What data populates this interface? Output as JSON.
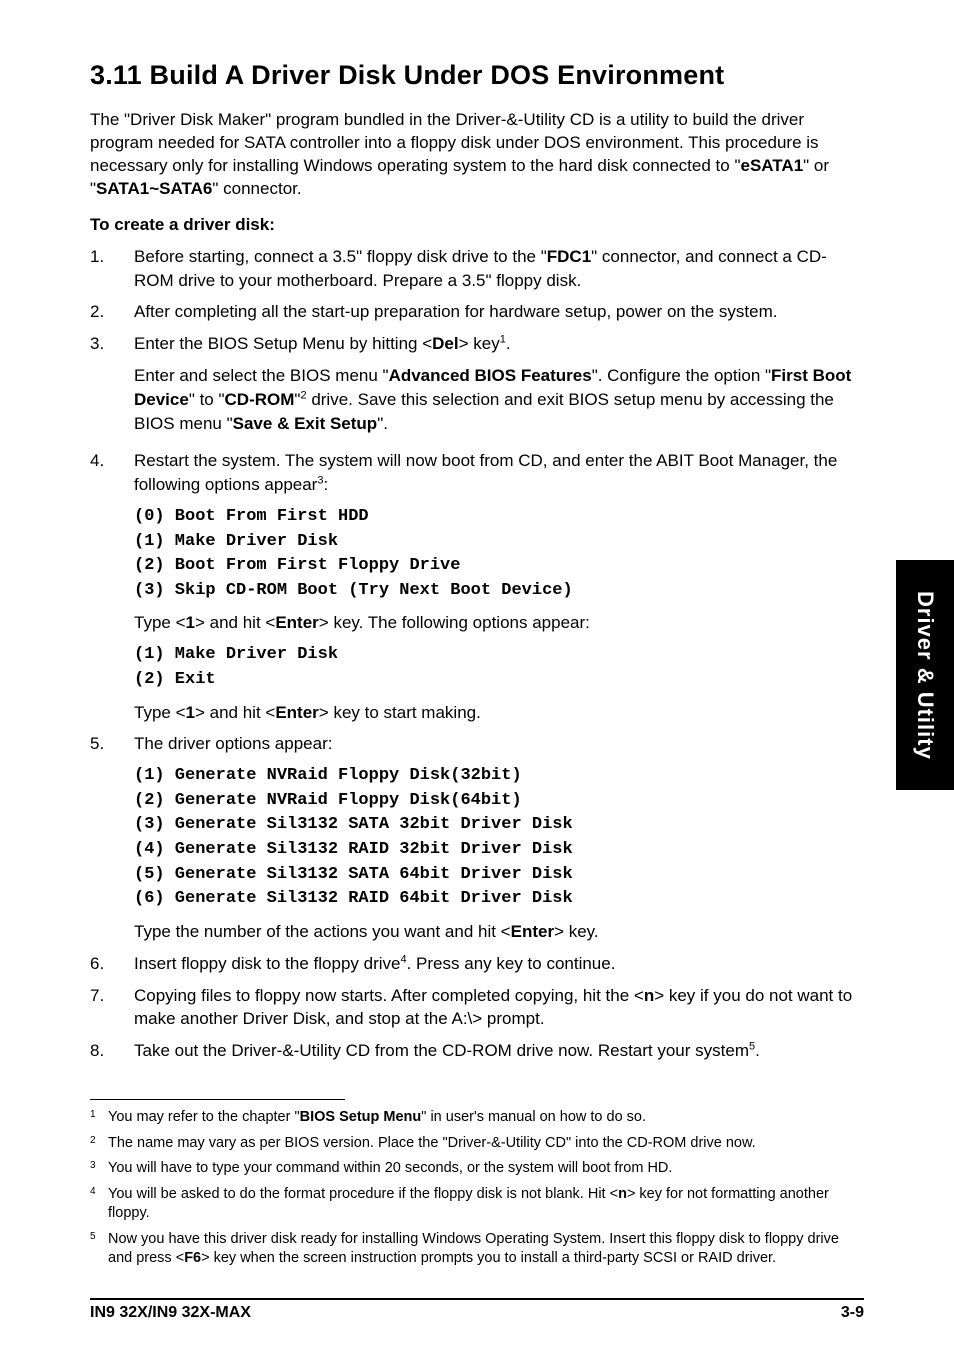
{
  "sideTab": "Driver & Utility",
  "title": "3.11 Build A Driver Disk Under DOS Environment",
  "intro": {
    "pre": "The \"Driver Disk Maker\" program bundled in the Driver-&-Utility CD is a utility to build the driver program needed for SATA controller into a floppy disk under DOS environment. This procedure is necessary only for installing Windows operating system to the hard disk connected to \"",
    "b1": "eSATA1",
    "mid": "\" or \"",
    "b2": "SATA1~SATA6",
    "post": "\" connector."
  },
  "subhead": "To create a driver disk:",
  "step1": {
    "pre": "Before starting, connect a 3.5\" floppy disk drive to the \"",
    "b": "FDC1",
    "post": "\" connector, and connect a CD-ROM drive to your motherboard. Prepare a 3.5\" floppy disk."
  },
  "step2": "After completing all the start-up preparation for hardware setup, power on the system.",
  "step3a": {
    "pre": "Enter the BIOS Setup Menu by hitting <",
    "b": "Del",
    "post": "> key",
    "sup": "1",
    "end": "."
  },
  "step3b": {
    "t1": "Enter and select the BIOS menu \"",
    "b1": "Advanced BIOS Features",
    "t2": "\". Configure the option \"",
    "b2": "First Boot Device",
    "t3": "\" to \"",
    "b3": "CD-ROM",
    "t4": "\"",
    "sup": "2",
    "t5": " drive. Save this selection and exit BIOS setup menu by accessing the BIOS menu \"",
    "b4": "Save & Exit Setup",
    "t6": "\"."
  },
  "step4a": {
    "t1": "Restart the system. The system will now boot from CD, and enter the ABIT Boot Manager, the following options appear",
    "sup": "3",
    "t2": ":"
  },
  "step4opts1": "(0) Boot From First HDD\n(1) Make Driver Disk\n(2) Boot From First Floppy Drive\n(3) Skip CD-ROM Boot (Try Next Boot Device)",
  "step4b": {
    "t1": "Type <",
    "b1": "1",
    "t2": "> and hit <",
    "b2": "Enter",
    "t3": "> key. The following options appear:"
  },
  "step4opts2": "(1) Make Driver Disk\n(2) Exit",
  "step4c": {
    "t1": "Type <",
    "b1": "1",
    "t2": "> and hit <",
    "b2": "Enter",
    "t3": "> key to start making."
  },
  "step5a": "The driver options appear:",
  "step5opts": "(1) Generate NVRaid Floppy Disk(32bit)\n(2) Generate NVRaid Floppy Disk(64bit)\n(3) Generate Sil3132 SATA 32bit Driver Disk\n(4) Generate Sil3132 RAID 32bit Driver Disk\n(5) Generate Sil3132 SATA 64bit Driver Disk\n(6) Generate Sil3132 RAID 64bit Driver Disk",
  "step5b": {
    "t1": "Type the number of the actions you want and hit <",
    "b1": "Enter",
    "t2": "> key."
  },
  "step6": {
    "t1": "Insert floppy disk to the floppy drive",
    "sup": "4",
    "t2": ". Press any key to continue."
  },
  "step7": {
    "t1": "Copying files to floppy now starts. After completed copying, hit the <",
    "b1": "n",
    "t2": "> key if you do not want to make another Driver Disk, and stop at the A:\\> prompt."
  },
  "step8": {
    "t1": "Take out the Driver-&-Utility CD from the CD-ROM drive now. Restart your system",
    "sup": "5",
    "t2": "."
  },
  "footnotes": {
    "f1": {
      "n": "1",
      "t1": "You may refer to the chapter \"",
      "b": "BIOS Setup Menu",
      "t2": "\" in user's manual on how to do so."
    },
    "f2": {
      "n": "2",
      "t": "The name may vary as per BIOS version. Place the \"Driver-&-Utility CD\" into the CD-ROM drive now."
    },
    "f3": {
      "n": "3",
      "t": "You will have to type your command within 20 seconds, or the system will boot from HD."
    },
    "f4": {
      "n": "4",
      "t1": "You will be asked to do the format procedure if the floppy disk is not blank. Hit <",
      "b": "n",
      "t2": "> key for not formatting another floppy."
    },
    "f5": {
      "n": "5",
      "t1": "Now you have this driver disk ready for installing Windows Operating System. Insert this floppy disk to floppy drive and press <",
      "b": "F6",
      "t2": "> key when the screen instruction prompts you to install a third-party SCSI or RAID driver."
    }
  },
  "footer": {
    "left": "IN9 32X/IN9 32X-MAX",
    "right": "3-9"
  }
}
